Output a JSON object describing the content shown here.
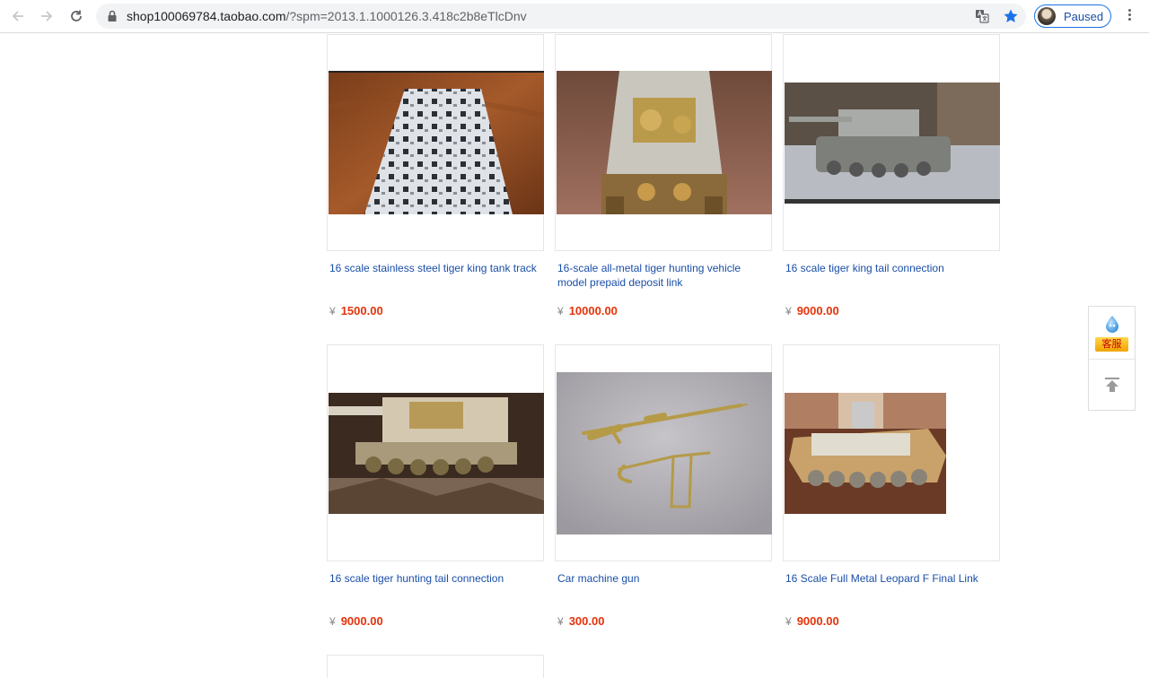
{
  "browser": {
    "url_host": "shop100069784.taobao.com",
    "url_path": "/?spm=2013.1.1000126.3.418c2b8eTlcDnv",
    "profile_label": "Paused"
  },
  "products": [
    {
      "title": "16 scale stainless steel tiger king tank track",
      "currency": "¥",
      "price": "1500.00"
    },
    {
      "title": "16-scale all-metal tiger hunting vehicle model prepaid deposit link",
      "currency": "¥",
      "price": "10000.00"
    },
    {
      "title": "16 scale tiger king tail connection",
      "currency": "¥",
      "price": "9000.00"
    },
    {
      "title": "16 scale tiger hunting tail connection",
      "currency": "¥",
      "price": "9000.00"
    },
    {
      "title": "Car machine gun",
      "currency": "¥",
      "price": "300.00"
    },
    {
      "title": "16 Scale Full Metal Leopard F Final Link",
      "currency": "¥",
      "price": "9000.00"
    }
  ],
  "side_widget": {
    "customer_service_label": "客服"
  }
}
